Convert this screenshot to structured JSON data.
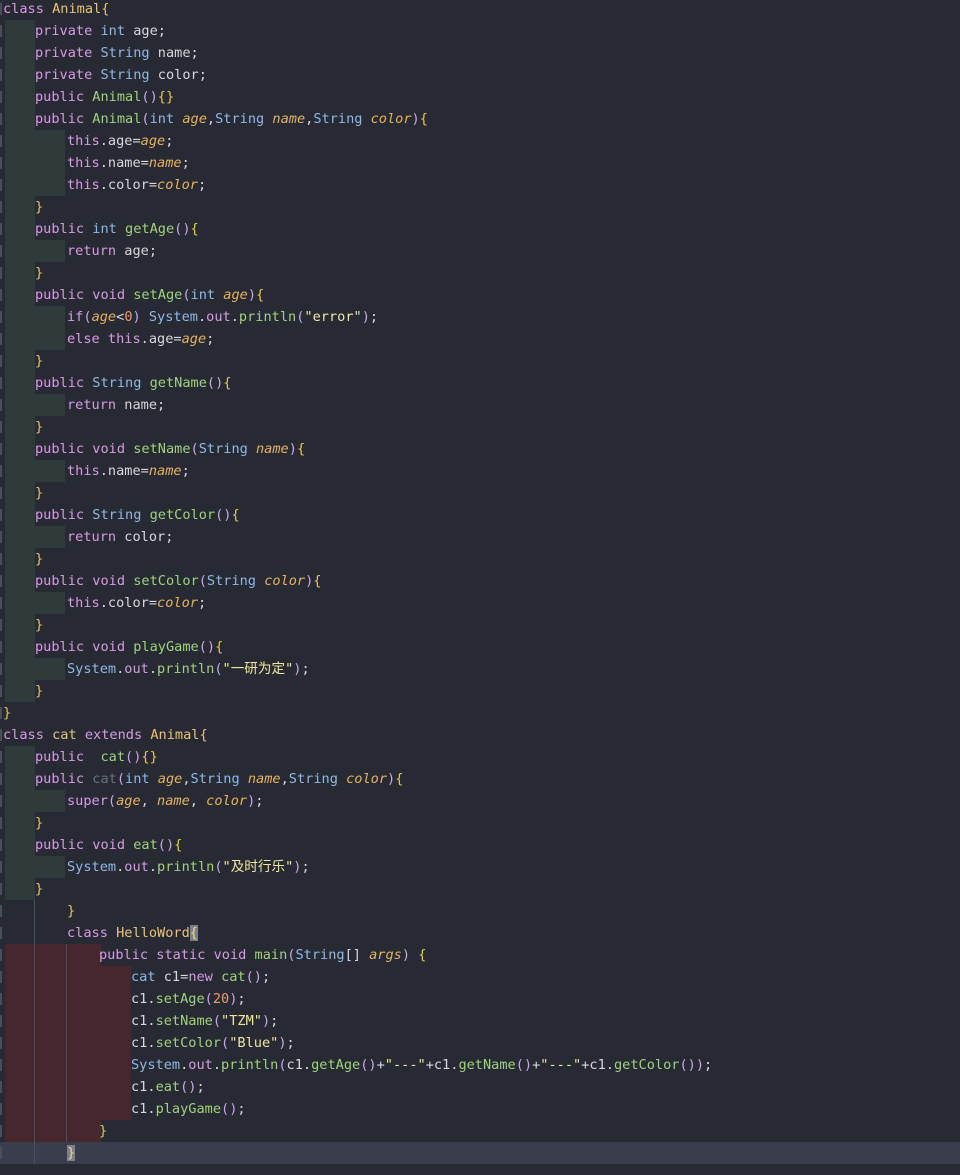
{
  "editor": {
    "lines": [
      [
        [
          "kw",
          "class "
        ],
        [
          "cls",
          "Animal"
        ],
        [
          "brace",
          "{"
        ]
      ],
      [
        [
          "kw",
          "private "
        ],
        [
          "type",
          "int "
        ],
        [
          "plain",
          "age;"
        ]
      ],
      [
        [
          "kw",
          "private "
        ],
        [
          "type",
          "String "
        ],
        [
          "plain",
          "name;"
        ]
      ],
      [
        [
          "kw",
          "private "
        ],
        [
          "type",
          "String "
        ],
        [
          "plain",
          "color;"
        ]
      ],
      [
        [
          "kw",
          "public "
        ],
        [
          "fn",
          "Animal"
        ],
        [
          "paren",
          "()"
        ],
        [
          "brace",
          "{}"
        ]
      ],
      [
        [
          "kw",
          "public "
        ],
        [
          "fn",
          "Animal"
        ],
        [
          "paren",
          "("
        ],
        [
          "type",
          "int "
        ],
        [
          "param",
          "age"
        ],
        [
          "plain",
          ","
        ],
        [
          "type",
          "String "
        ],
        [
          "param",
          "name"
        ],
        [
          "plain",
          ","
        ],
        [
          "type",
          "String "
        ],
        [
          "param",
          "color"
        ],
        [
          "paren",
          ")"
        ],
        [
          "brace",
          "{"
        ]
      ],
      [
        [
          "kw",
          "this"
        ],
        [
          "plain",
          ".age="
        ],
        [
          "param",
          "age"
        ],
        [
          "plain",
          ";"
        ]
      ],
      [
        [
          "kw",
          "this"
        ],
        [
          "plain",
          ".name="
        ],
        [
          "param",
          "name"
        ],
        [
          "plain",
          ";"
        ]
      ],
      [
        [
          "kw",
          "this"
        ],
        [
          "plain",
          ".color="
        ],
        [
          "param",
          "color"
        ],
        [
          "plain",
          ";"
        ]
      ],
      [
        [
          "brace",
          "}"
        ]
      ],
      [
        [
          "kw",
          "public "
        ],
        [
          "type",
          "int "
        ],
        [
          "fn",
          "getAge"
        ],
        [
          "paren",
          "()"
        ],
        [
          "brace",
          "{"
        ]
      ],
      [
        [
          "kw",
          "return "
        ],
        [
          "plain",
          "age;"
        ]
      ],
      [
        [
          "brace",
          "}"
        ]
      ],
      [
        [
          "kw",
          "public "
        ],
        [
          "kw",
          "void "
        ],
        [
          "fn",
          "setAge"
        ],
        [
          "paren",
          "("
        ],
        [
          "type",
          "int "
        ],
        [
          "param",
          "age"
        ],
        [
          "paren",
          ")"
        ],
        [
          "brace",
          "{"
        ]
      ],
      [
        [
          "kw",
          "if"
        ],
        [
          "paren",
          "("
        ],
        [
          "param",
          "age"
        ],
        [
          "plain",
          "<"
        ],
        [
          "num",
          "0"
        ],
        [
          "paren",
          ") "
        ],
        [
          "type",
          "System"
        ],
        [
          "plain",
          "."
        ],
        [
          "staticf",
          "out"
        ],
        [
          "plain",
          "."
        ],
        [
          "fn",
          "println"
        ],
        [
          "paren",
          "("
        ],
        [
          "str",
          "\"error\""
        ],
        [
          "paren",
          ")"
        ],
        [
          "plain",
          ";"
        ]
      ],
      [
        [
          "kw",
          "else "
        ],
        [
          "kw",
          "this"
        ],
        [
          "plain",
          ".age="
        ],
        [
          "param",
          "age"
        ],
        [
          "plain",
          ";"
        ]
      ],
      [
        [
          "brace",
          "}"
        ]
      ],
      [
        [
          "kw",
          "public "
        ],
        [
          "type",
          "String "
        ],
        [
          "fn",
          "getName"
        ],
        [
          "paren",
          "()"
        ],
        [
          "brace",
          "{"
        ]
      ],
      [
        [
          "kw",
          "return "
        ],
        [
          "plain",
          "name;"
        ]
      ],
      [
        [
          "brace",
          "}"
        ]
      ],
      [
        [
          "kw",
          "public "
        ],
        [
          "kw",
          "void "
        ],
        [
          "fn",
          "setName"
        ],
        [
          "paren",
          "("
        ],
        [
          "type",
          "String "
        ],
        [
          "param",
          "name"
        ],
        [
          "paren",
          ")"
        ],
        [
          "brace",
          "{"
        ]
      ],
      [
        [
          "kw",
          "this"
        ],
        [
          "plain",
          ".name="
        ],
        [
          "param",
          "name"
        ],
        [
          "plain",
          ";"
        ]
      ],
      [
        [
          "brace",
          "}"
        ]
      ],
      [
        [
          "kw",
          "public "
        ],
        [
          "type",
          "String "
        ],
        [
          "fn",
          "getColor"
        ],
        [
          "paren",
          "()"
        ],
        [
          "brace",
          "{"
        ]
      ],
      [
        [
          "kw",
          "return "
        ],
        [
          "plain",
          "color;"
        ]
      ],
      [
        [
          "brace",
          "}"
        ]
      ],
      [
        [
          "kw",
          "public "
        ],
        [
          "kw",
          "void "
        ],
        [
          "fn",
          "setColor"
        ],
        [
          "paren",
          "("
        ],
        [
          "type",
          "String "
        ],
        [
          "param",
          "color"
        ],
        [
          "paren",
          ")"
        ],
        [
          "brace",
          "{"
        ]
      ],
      [
        [
          "kw",
          "this"
        ],
        [
          "plain",
          ".color="
        ],
        [
          "param",
          "color"
        ],
        [
          "plain",
          ";"
        ]
      ],
      [
        [
          "brace",
          "}"
        ]
      ],
      [
        [
          "kw",
          "public "
        ],
        [
          "kw",
          "void "
        ],
        [
          "fn",
          "playGame"
        ],
        [
          "paren",
          "()"
        ],
        [
          "brace",
          "{"
        ]
      ],
      [
        [
          "type",
          "System"
        ],
        [
          "plain",
          "."
        ],
        [
          "staticf",
          "out"
        ],
        [
          "plain",
          "."
        ],
        [
          "fn",
          "println"
        ],
        [
          "paren",
          "("
        ],
        [
          "str",
          "\"一研为定\""
        ],
        [
          "paren",
          ")"
        ],
        [
          "plain",
          ";"
        ]
      ],
      [
        [
          "brace",
          "}"
        ]
      ],
      [
        [
          "brace",
          "}"
        ]
      ],
      [
        [
          "kw",
          "class "
        ],
        [
          "cls",
          "cat "
        ],
        [
          "kw",
          "extends "
        ],
        [
          "cls",
          "Animal"
        ],
        [
          "brace",
          "{"
        ]
      ],
      [
        [
          "kw",
          "public  "
        ],
        [
          "fn",
          "cat"
        ],
        [
          "paren",
          "()"
        ],
        [
          "brace",
          "{}"
        ]
      ],
      [
        [
          "kw",
          "public "
        ],
        [
          "dim",
          "cat"
        ],
        [
          "paren",
          "("
        ],
        [
          "type",
          "int "
        ],
        [
          "param",
          "age"
        ],
        [
          "plain",
          ","
        ],
        [
          "type",
          "String "
        ],
        [
          "param",
          "name"
        ],
        [
          "plain",
          ","
        ],
        [
          "type",
          "String "
        ],
        [
          "param",
          "color"
        ],
        [
          "paren",
          ")"
        ],
        [
          "brace",
          "{"
        ]
      ],
      [
        [
          "kw",
          "super"
        ],
        [
          "paren",
          "("
        ],
        [
          "param",
          "age"
        ],
        [
          "plain",
          ", "
        ],
        [
          "param",
          "name"
        ],
        [
          "plain",
          ", "
        ],
        [
          "param",
          "color"
        ],
        [
          "paren",
          ")"
        ],
        [
          "plain",
          ";"
        ]
      ],
      [
        [
          "brace",
          "}"
        ]
      ],
      [
        [
          "kw",
          "public "
        ],
        [
          "kw",
          "void "
        ],
        [
          "fn",
          "eat"
        ],
        [
          "paren",
          "()"
        ],
        [
          "brace",
          "{"
        ]
      ],
      [
        [
          "type",
          "System"
        ],
        [
          "plain",
          "."
        ],
        [
          "staticf",
          "out"
        ],
        [
          "plain",
          "."
        ],
        [
          "fn",
          "println"
        ],
        [
          "paren",
          "("
        ],
        [
          "str",
          "\"及时行乐\""
        ],
        [
          "paren",
          ")"
        ],
        [
          "plain",
          ";"
        ]
      ],
      [
        [
          "brace",
          "}"
        ]
      ],
      [
        [
          "brace",
          "}"
        ]
      ],
      [
        [
          "kw",
          "class "
        ],
        [
          "cls",
          "HelloWord"
        ],
        [
          "cursor",
          "{"
        ]
      ],
      [
        [
          "kw",
          "public "
        ],
        [
          "kw",
          "static "
        ],
        [
          "kw",
          "void "
        ],
        [
          "fn",
          "main"
        ],
        [
          "paren",
          "("
        ],
        [
          "type",
          "String"
        ],
        [
          "plain",
          "[] "
        ],
        [
          "param",
          "args"
        ],
        [
          "paren",
          ") "
        ],
        [
          "brace",
          "{"
        ]
      ],
      [
        [
          "type",
          "cat "
        ],
        [
          "plain",
          "c1="
        ],
        [
          "kw",
          "new "
        ],
        [
          "fn",
          "cat"
        ],
        [
          "paren",
          "()"
        ],
        [
          "plain",
          ";"
        ]
      ],
      [
        [
          "plain",
          "c1."
        ],
        [
          "fn",
          "setAge"
        ],
        [
          "paren",
          "("
        ],
        [
          "num",
          "20"
        ],
        [
          "paren",
          ")"
        ],
        [
          "plain",
          ";"
        ]
      ],
      [
        [
          "plain",
          "c1."
        ],
        [
          "fn",
          "setName"
        ],
        [
          "paren",
          "("
        ],
        [
          "str",
          "\"TZM\""
        ],
        [
          "paren",
          ")"
        ],
        [
          "plain",
          ";"
        ]
      ],
      [
        [
          "plain",
          "c1."
        ],
        [
          "fn",
          "setColor"
        ],
        [
          "paren",
          "("
        ],
        [
          "str",
          "\"Blue\""
        ],
        [
          "paren",
          ")"
        ],
        [
          "plain",
          ";"
        ]
      ],
      [
        [
          "type",
          "System"
        ],
        [
          "plain",
          "."
        ],
        [
          "staticf",
          "out"
        ],
        [
          "plain",
          "."
        ],
        [
          "fn",
          "println"
        ],
        [
          "paren",
          "("
        ],
        [
          "plain",
          "c1."
        ],
        [
          "fn",
          "getAge"
        ],
        [
          "paren",
          "()"
        ],
        [
          "plain",
          "+"
        ],
        [
          "str",
          "\"---\""
        ],
        [
          "plain",
          "+c1."
        ],
        [
          "fn",
          "getName"
        ],
        [
          "paren",
          "()"
        ],
        [
          "plain",
          "+"
        ],
        [
          "str",
          "\"---\""
        ],
        [
          "plain",
          "+c1."
        ],
        [
          "fn",
          "getColor"
        ],
        [
          "paren",
          "())"
        ],
        [
          "plain",
          ";"
        ]
      ],
      [
        [
          "plain",
          "c1."
        ],
        [
          "fn",
          "eat"
        ],
        [
          "paren",
          "()"
        ],
        [
          "plain",
          ";"
        ]
      ],
      [
        [
          "plain",
          "c1."
        ],
        [
          "fn",
          "playGame"
        ],
        [
          "paren",
          "()"
        ],
        [
          "plain",
          ";"
        ]
      ],
      [
        [
          "brace",
          "}"
        ]
      ],
      [
        [
          "cursor",
          "}"
        ]
      ]
    ]
  }
}
